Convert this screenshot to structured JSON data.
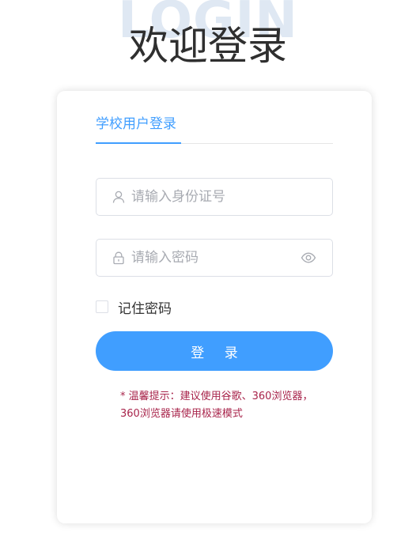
{
  "header": {
    "background_word": "LOGIN",
    "title": "欢迎登录"
  },
  "tabs": [
    {
      "label": "学校用户登录",
      "active": true
    }
  ],
  "form": {
    "id_placeholder": "请输入身份证号",
    "id_value": "",
    "password_placeholder": "请输入密码",
    "password_value": "",
    "remember_label": "记住密码",
    "remember_checked": false,
    "login_label": "登 录"
  },
  "tip": "* 温馨提示：建议使用谷歌、360浏览器，360浏览器请使用极速模式",
  "colors": {
    "accent": "#409eff",
    "tip": "#a8244b",
    "title": "#2f2f2f"
  },
  "icons": {
    "id_field": "user-icon",
    "password_field": "lock-icon",
    "password_toggle": "eye-icon"
  }
}
